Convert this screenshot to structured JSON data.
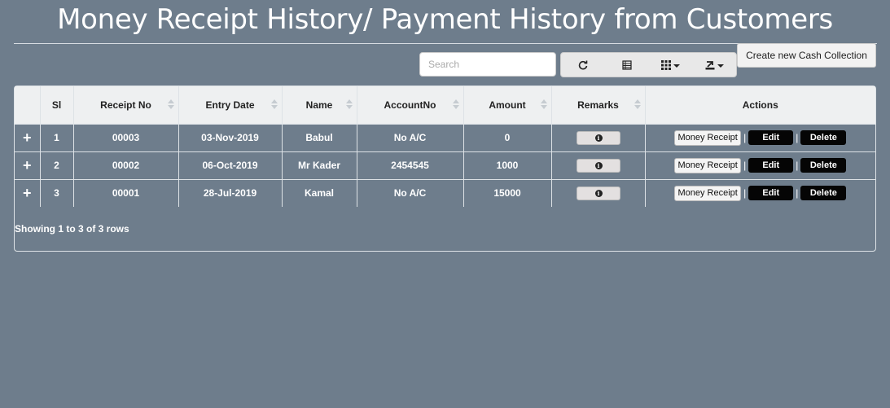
{
  "page": {
    "title": "Money Receipt History/ Payment History from Customers"
  },
  "toolbar": {
    "search_placeholder": "Search",
    "buttons": [
      {
        "icon": "refresh-icon"
      },
      {
        "icon": "toggle-view-icon"
      },
      {
        "icon": "columns-icon",
        "dropdown": true
      },
      {
        "icon": "export-icon",
        "dropdown": true
      }
    ],
    "create_label": "Create new Cash Collection"
  },
  "table": {
    "columns": [
      "",
      "Sl",
      "Receipt No",
      "Entry Date",
      "Name",
      "AccountNo",
      "Amount",
      "Remarks",
      "Actions"
    ],
    "rows": [
      {
        "expand": "+",
        "sl": "1",
        "receipt_no": "00003",
        "entry_date": "03-Nov-2019",
        "name": "Babul",
        "account_no": "No A/C",
        "amount": "0"
      },
      {
        "expand": "+",
        "sl": "2",
        "receipt_no": "00002",
        "entry_date": "06-Oct-2019",
        "name": "Mr Kader",
        "account_no": "2454545",
        "amount": "1000"
      },
      {
        "expand": "+",
        "sl": "3",
        "receipt_no": "00001",
        "entry_date": "28-Jul-2019",
        "name": "Kamal",
        "account_no": "No A/C",
        "amount": "15000"
      }
    ],
    "actions": {
      "money_receipt": "Money Receipt",
      "separator": "|",
      "edit": "Edit",
      "delete": "Delete"
    },
    "remarks_icon": "info-icon",
    "footer": "Showing 1 to 3 of 3 rows"
  },
  "colors": {
    "background": "#6e7d8c",
    "header_bg": "#eef0f1",
    "action_dark": "#050505"
  }
}
